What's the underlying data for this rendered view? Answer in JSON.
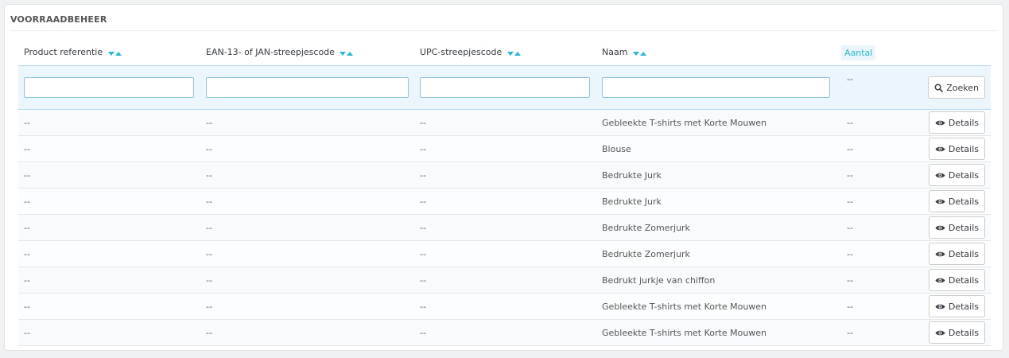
{
  "panel": {
    "title": "VOORRAADBEHEER"
  },
  "columns": [
    {
      "label": "Product referentie",
      "sortable": true
    },
    {
      "label": "EAN-13- of JAN-streepjescode",
      "sortable": true
    },
    {
      "label": "UPC-streepjescode",
      "sortable": true
    },
    {
      "label": "Naam",
      "sortable": true
    },
    {
      "label": "Aantal",
      "sortable": false
    }
  ],
  "filters": {
    "quantity_placeholder": "--",
    "search_label": "Zoeken"
  },
  "rows": [
    {
      "reference": "--",
      "ean13": "--",
      "upc": "--",
      "name": "Gebleekte T-shirts met Korte Mouwen",
      "quantity": "--",
      "action": "Details"
    },
    {
      "reference": "--",
      "ean13": "--",
      "upc": "--",
      "name": "Blouse",
      "quantity": "--",
      "action": "Details"
    },
    {
      "reference": "--",
      "ean13": "--",
      "upc": "--",
      "name": "Bedrukte Jurk",
      "quantity": "--",
      "action": "Details"
    },
    {
      "reference": "--",
      "ean13": "--",
      "upc": "--",
      "name": "Bedrukte Jurk",
      "quantity": "--",
      "action": "Details"
    },
    {
      "reference": "--",
      "ean13": "--",
      "upc": "--",
      "name": "Bedrukte Zomerjurk",
      "quantity": "--",
      "action": "Details"
    },
    {
      "reference": "--",
      "ean13": "--",
      "upc": "--",
      "name": "Bedrukte Zomerjurk",
      "quantity": "--",
      "action": "Details"
    },
    {
      "reference": "--",
      "ean13": "--",
      "upc": "--",
      "name": "Bedrukt jurkje van chiffon",
      "quantity": "--",
      "action": "Details"
    },
    {
      "reference": "--",
      "ean13": "--",
      "upc": "--",
      "name": "Gebleekte T-shirts met Korte Mouwen",
      "quantity": "--",
      "action": "Details"
    },
    {
      "reference": "--",
      "ean13": "--",
      "upc": "--",
      "name": "Gebleekte T-shirts met Korte Mouwen",
      "quantity": "--",
      "action": "Details"
    }
  ],
  "icons": {
    "search": "search-icon",
    "details": "eye-icon",
    "sort_desc": "caret-down-icon",
    "sort_asc": "caret-up-icon"
  },
  "colors": {
    "accent": "#25b9d7",
    "filter_bg": "#eaf6fb"
  }
}
